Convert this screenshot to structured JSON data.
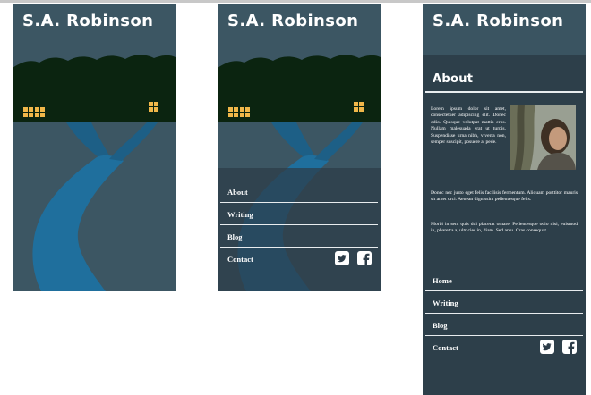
{
  "site_title": "S.A. Robinson",
  "menu_nav": [
    "About",
    "Writing",
    "Blog",
    "Contact"
  ],
  "about": {
    "heading": "About",
    "p1": "Lorem ipsum dolor sit amet, consectetuer adipiscing elit. Donec odio. Quisque volutpat mattis eros. Nullam malesuada erat ut turpis. Suspendisse urna nibh, viverra non, semper suscipit, posuere a, pede.",
    "p2": "Donec nec justo eget felis facilisis fermentum. Aliquam porttitor mauris sit amet orci. Aenean dignissim pellentesque felis.",
    "p3": "Morbi in sem quis dui placerat ornare. Pellentesque odio nisi, euismod in, pharetra a, ultricies in, diam. Sed arcu. Cras consequat."
  },
  "about_nav": [
    "Home",
    "Writing",
    "Blog",
    "Contact"
  ],
  "social": [
    "twitter-icon",
    "facebook-icon"
  ],
  "colors": {
    "panel_bg": "#3c5663",
    "about_bg": "#2d3f4a",
    "tree": "#0b2410",
    "river": "#1f6f9d",
    "window": "#f0b74a"
  }
}
